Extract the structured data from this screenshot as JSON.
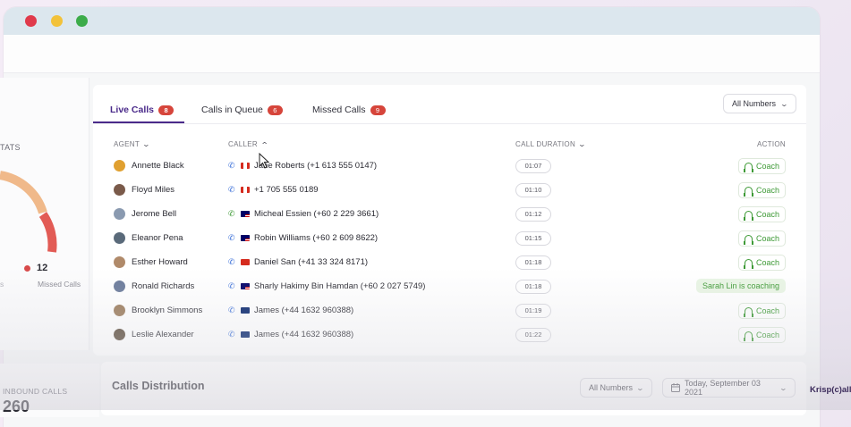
{
  "window": {
    "traffic_lights": [
      "close",
      "minimize",
      "maximize"
    ]
  },
  "stats": {
    "section_label": "TATS",
    "missed_calls_value": "12",
    "missed_calls_label": "Missed Calls",
    "truncated_left_label": "s"
  },
  "tabs": [
    {
      "label": "Live Calls",
      "count": "8",
      "active": true
    },
    {
      "label": "Calls in Queue",
      "count": "6",
      "active": false
    },
    {
      "label": "Missed Calls",
      "count": "9",
      "active": false
    }
  ],
  "number_filter": {
    "label": "All Numbers"
  },
  "table": {
    "headers": {
      "agent": "AGENT",
      "caller": "CALLER",
      "duration": "CALL DURATION",
      "action": "ACTION"
    },
    "rows": [
      {
        "agent": "Annette Black",
        "caller": "Jane Roberts (+1 613 555 0147)",
        "flag": "canada",
        "duration": "01:07",
        "action": "Coach",
        "avatar_color": "#e0a030"
      },
      {
        "agent": "Floyd Miles",
        "caller": "+1 705 555 0189",
        "flag": "canada",
        "duration": "01:10",
        "action": "Coach",
        "avatar_color": "#7a5a4a"
      },
      {
        "agent": "Jerome Bell",
        "caller": "Micheal Essien (+60 2 229 3661)",
        "flag": "malaysia",
        "duration": "01:12",
        "action": "Coach",
        "avatar_color": "#8a9ab0"
      },
      {
        "agent": "Eleanor Pena",
        "caller": "Robin Williams (+60 2 609 8622)",
        "flag": "malaysia",
        "duration": "01:15",
        "action": "Coach",
        "avatar_color": "#5a6a7a"
      },
      {
        "agent": "Esther Howard",
        "caller": "Daniel San (+41 33 324 8171)",
        "flag": "switzerland",
        "duration": "01:18",
        "action": "Coach",
        "avatar_color": "#b08a6a"
      },
      {
        "agent": "Ronald Richards",
        "caller": "Sharly Hakimy Bin Hamdan (+60 2 027 5749)",
        "flag": "malaysia",
        "duration": "01:18",
        "action": "Sarah Lin is coaching",
        "avatar_color": "#6a7a9a"
      },
      {
        "agent": "Brooklyn Simmons",
        "caller": "James (+44 1632 960388)",
        "flag": "uk",
        "duration": "01:19",
        "action": "Coach",
        "avatar_color": "#9a7a5a"
      },
      {
        "agent": "Leslie Alexander",
        "caller": "James (+44 1632 960388)",
        "flag": "uk",
        "duration": "01:22",
        "action": "Coach",
        "avatar_color": "#5a4a3a"
      }
    ]
  },
  "inbound": {
    "label": "INBOUND CALLS",
    "value": "260"
  },
  "distribution": {
    "title": "Calls Distribution",
    "numbers_filter": "All Numbers",
    "date_filter": "Today, September 03 2021"
  },
  "brand": "Krisp(c)all",
  "colors": {
    "accent": "#4a2a8a",
    "badge": "#d6453b",
    "coach": "#3e9a36"
  }
}
